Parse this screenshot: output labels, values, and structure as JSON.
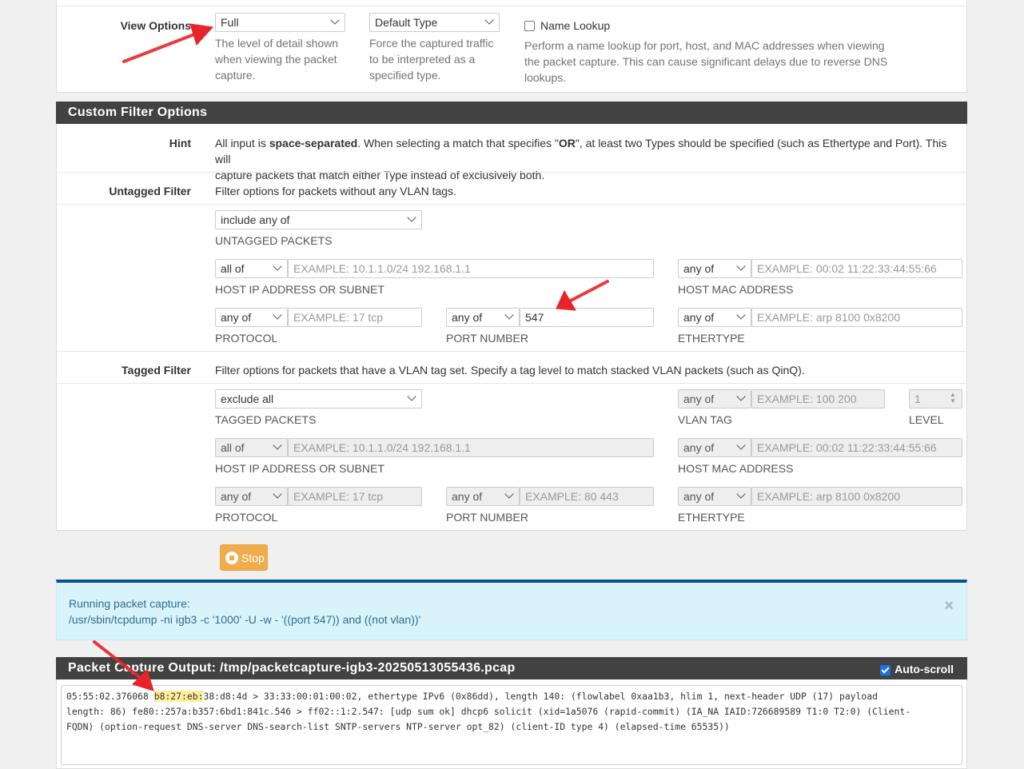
{
  "view_options": {
    "label": "View Options",
    "detail_select": "Full",
    "detail_help": [
      "The level of detail shown",
      "when viewing the packet",
      "capture."
    ],
    "type_select": "Default Type",
    "type_help": [
      "Force the captured traffic",
      "to be interpreted as a",
      "specified type."
    ],
    "name_lookup_label": "Name Lookup",
    "name_lookup_help": [
      "Perform a name lookup for port, host, and MAC addresses when viewing",
      "the packet capture. This can cause significant delays due to reverse DNS",
      "lookups."
    ]
  },
  "custom_filter": {
    "heading": "Custom Filter Options",
    "hint_label": "Hint",
    "hint_pre": "All input is ",
    "hint_bold1": "space-separated",
    "hint_mid": ". When selecting a match that specifies \"",
    "hint_bold2": "OR",
    "hint_post": "\", at least two Types should be specified (such as Ethertype and Port). This will",
    "hint_line2": "capture packets that match either Type instead of exclusively both.",
    "untagged": {
      "label": "Untagged Filter",
      "help": "Filter options for packets without any VLAN tags.",
      "packets_select": "include any of",
      "packets_caption": "UNTAGGED PACKETS",
      "host_ip_select": "all of",
      "host_ip_placeholder": "EXAMPLE: 10.1.1.0/24 192.168.1.1",
      "host_ip_caption": "HOST IP ADDRESS OR SUBNET",
      "host_mac_select": "any of",
      "host_mac_placeholder": "EXAMPLE: 00:02 11:22:33:44:55:66",
      "host_mac_caption": "HOST MAC ADDRESS",
      "protocol_select": "any of",
      "protocol_placeholder": "EXAMPLE: 17 tcp",
      "protocol_caption": "PROTOCOL",
      "port_select": "any of",
      "port_value": "547",
      "port_caption": "PORT NUMBER",
      "ethertype_select": "any of",
      "ethertype_placeholder": "EXAMPLE: arp 8100 0x8200",
      "ethertype_caption": "ETHERTYPE"
    },
    "tagged": {
      "label": "Tagged Filter",
      "help": "Filter options for packets that have a VLAN tag set. Specify a tag level to match stacked VLAN packets (such as QinQ).",
      "packets_select": "exclude all",
      "packets_caption": "TAGGED PACKETS",
      "vlan_select": "any of",
      "vlan_placeholder": "EXAMPLE: 100 200",
      "vlan_caption": "VLAN TAG",
      "level_value": "1",
      "level_caption": "LEVEL",
      "host_ip_select": "all of",
      "host_ip_placeholder": "EXAMPLE: 10.1.1.0/24 192.168.1.1",
      "host_ip_caption": "HOST IP ADDRESS OR SUBNET",
      "host_mac_select": "any of",
      "host_mac_placeholder": "EXAMPLE: 00:02 11:22:33:44:55:66",
      "host_mac_caption": "HOST MAC ADDRESS",
      "protocol_select": "any of",
      "protocol_placeholder": "EXAMPLE: 17 tcp",
      "protocol_caption": "PROTOCOL",
      "port_select": "any of",
      "port_placeholder": "EXAMPLE: 80 443",
      "port_caption": "PORT NUMBER",
      "ethertype_select": "any of",
      "ethertype_placeholder": "EXAMPLE: arp 8100 0x8200",
      "ethertype_caption": "ETHERTYPE"
    }
  },
  "stop_button": "Stop",
  "alert": {
    "line1": "Running packet capture:",
    "line2": "/usr/sbin/tcpdump -ni igb3 -c '1000' -U -w - '((port 547)) and ((not vlan))'",
    "close": "×"
  },
  "output": {
    "heading": "Packet Capture Output: /tmp/packetcapture-igb3-20250513055436.pcap",
    "autoscroll_label": "Auto-scroll",
    "line1_pre": "05:55:02.376068 ",
    "line1_hl": "b8:27:eb:",
    "line1_post": "38:d8:4d > 33:33:00:01:00:02, ethertype IPv6 (0x86dd), length 140: (flowlabel 0xaa1b3, hlim 1, next-header UDP (17) payload",
    "line2": "length: 86) fe80::257a:b357:6bd1:841c.546 > ff02::1:2.547: [udp sum ok] dhcp6 solicit (xid=1a5076 (rapid-commit) (IA_NA IAID:726689589 T1:0 T2:0) (Client-",
    "line3": "FQDN) (option-request DNS-server DNS-search-list SNTP-servers NTP-server opt_82) (client-ID type 4) (elapsed-time 65535))"
  },
  "colors": {
    "heading_bg": "#424242",
    "alert_bg": "#d9f3fb",
    "alert_border": "#06558a",
    "stop_button": "#f0ad4e",
    "highlight": "#ffef9a",
    "annotation_arrow": "#e8232a"
  }
}
